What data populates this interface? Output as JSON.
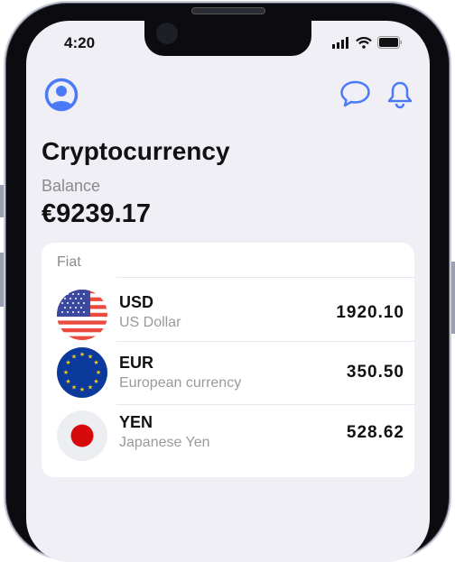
{
  "status_bar": {
    "time": "4:20"
  },
  "header": {
    "profile_icon": "user-circle-icon",
    "chat_icon": "chat-bubble-icon",
    "bell_icon": "bell-icon",
    "accent": "#4a7af5"
  },
  "title": "Cryptocurrency",
  "balance": {
    "label": "Balance",
    "value": "€9239.17"
  },
  "fiat": {
    "label": "Fiat",
    "items": [
      {
        "code": "USD",
        "name": "US Dollar",
        "amount": "1920.10",
        "flag": "us-flag-icon"
      },
      {
        "code": "EUR",
        "name": "European currency",
        "amount": "350.50",
        "flag": "eu-flag-icon"
      },
      {
        "code": "YEN",
        "name": "Japanese Yen",
        "amount": "528.62",
        "flag": "jp-flag-icon"
      }
    ]
  }
}
